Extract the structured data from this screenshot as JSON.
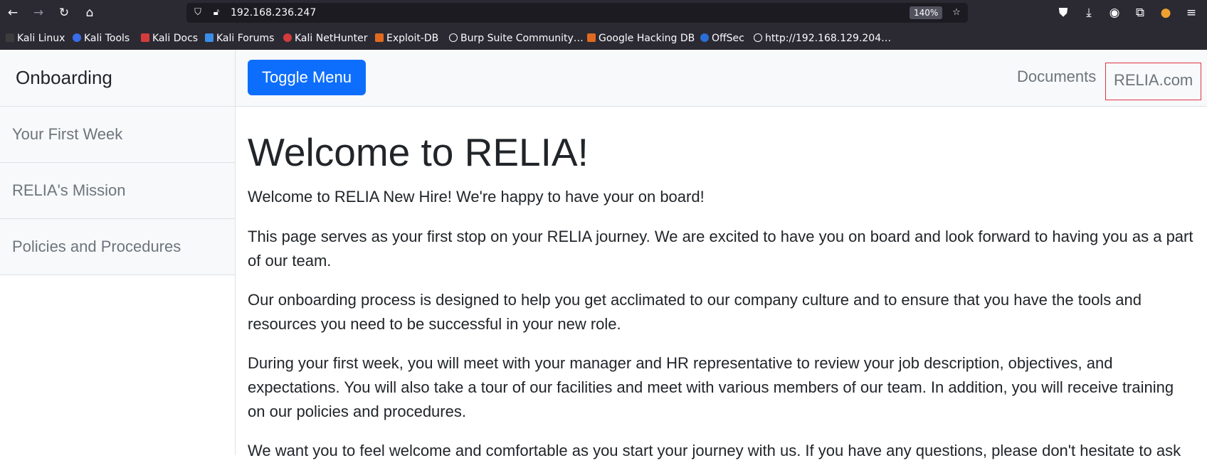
{
  "browser": {
    "url": "192.168.236.247",
    "zoom": "140%",
    "bookmarks": [
      {
        "label": "Kali Linux",
        "color": "#3c3c3c"
      },
      {
        "label": "Kali Tools",
        "color": "#3a6ee8"
      },
      {
        "label": "Kali Docs",
        "color": "#d43c3c"
      },
      {
        "label": "Kali Forums",
        "color": "#3a8ee8"
      },
      {
        "label": "Kali NetHunter",
        "color": "#d43c3c"
      },
      {
        "label": "Exploit-DB",
        "color": "#e06a20"
      },
      {
        "label": "Burp Suite Community…",
        "color": "#8f8f9d"
      },
      {
        "label": "Google Hacking DB",
        "color": "#e06a20"
      },
      {
        "label": "OffSec",
        "color": "#2b6fd6"
      },
      {
        "label": "http://192.168.129.204…",
        "color": "#8f8f9d"
      }
    ]
  },
  "sidebar": {
    "title": "Onboarding",
    "items": [
      {
        "label": "Your First Week"
      },
      {
        "label": "RELIA's Mission"
      },
      {
        "label": "Policies and Procedures"
      }
    ]
  },
  "navbar": {
    "toggle_label": "Toggle Menu",
    "links": [
      {
        "label": "Documents"
      },
      {
        "label": "RELIA.com"
      }
    ]
  },
  "main": {
    "heading": "Welcome to RELIA!",
    "paragraphs": [
      "Welcome to RELIA New Hire! We're happy to have your on board!",
      "This page serves as your first stop on your RELIA journey. We are excited to have you on board and look forward to having you as a part of our team.",
      "Our onboarding process is designed to help you get acclimated to our company culture and to ensure that you have the tools and resources you need to be successful in your new role.",
      "During your first week, you will meet with your manager and HR representative to review your job description, objectives, and expectations. You will also take a tour of our facilities and meet with various members of our team. In addition, you will receive training on our policies and procedures.",
      "We want you to feel welcome and comfortable as you start your journey with us. If you have any questions, please don't hesitate to ask"
    ]
  },
  "colors": {
    "accent": "#0d6efd",
    "highlight_border": "#dc3545"
  }
}
